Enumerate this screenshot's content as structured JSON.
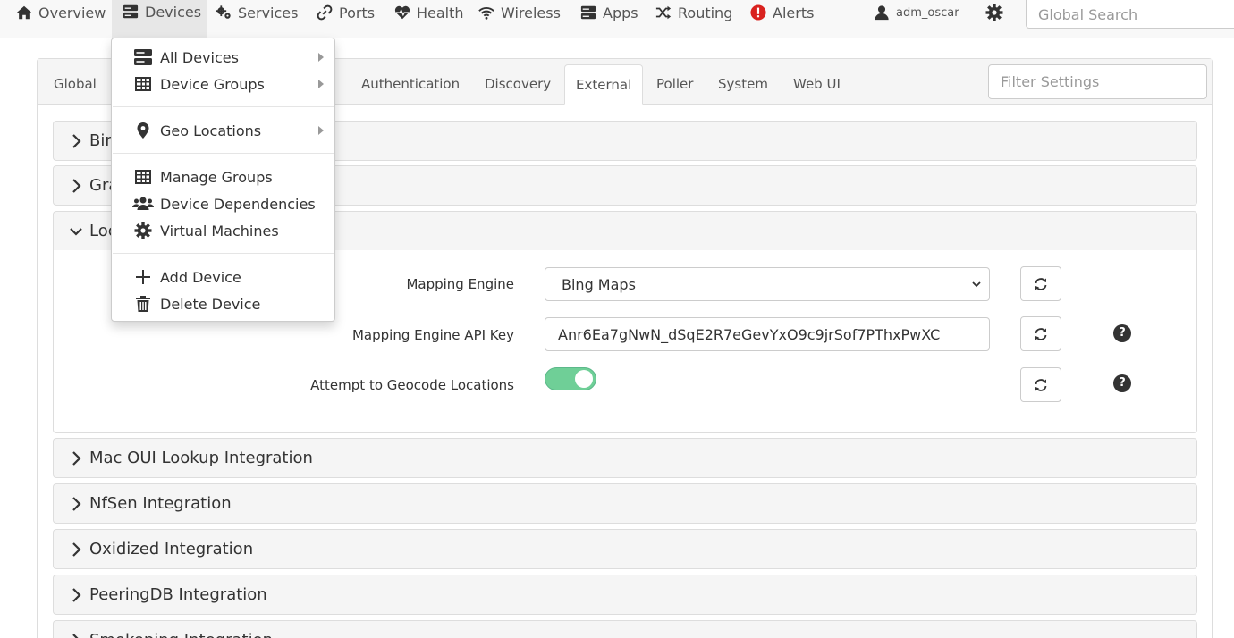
{
  "nav": {
    "items": [
      {
        "label": "Overview",
        "icon": "home-icon"
      },
      {
        "label": "Devices",
        "icon": "server-icon"
      },
      {
        "label": "Services",
        "icon": "cogs-icon"
      },
      {
        "label": "Ports",
        "icon": "link-icon"
      },
      {
        "label": "Health",
        "icon": "heartbeat-icon"
      },
      {
        "label": "Wireless",
        "icon": "wifi-icon"
      },
      {
        "label": "Apps",
        "icon": "server-icon"
      },
      {
        "label": "Routing",
        "icon": "random-icon"
      },
      {
        "label": "Alerts",
        "icon": "exclamation-circle-icon"
      }
    ],
    "user": "adm_oscar",
    "search_placeholder": "Global Search",
    "alert_color": "#d9221f"
  },
  "tabs": [
    "Global",
    "Authentication",
    "Discovery",
    "External",
    "Poller",
    "System",
    "Web UI"
  ],
  "active_tab": "External",
  "filter_placeholder": "Filter Settings",
  "sections": {
    "bing": "Bir",
    "graphing": "Gra",
    "location": "Loc",
    "mac_oui": "Mac OUI Lookup Integration",
    "nfsen": "NfSen Integration",
    "oxidized": "Oxidized Integration",
    "peeringdb": "PeeringDB Integration",
    "smokeping": "Smokeping Integration"
  },
  "location_settings": {
    "mapping_engine_label": "Mapping Engine",
    "mapping_engine_value": "Bing Maps",
    "api_key_label": "Mapping Engine API Key",
    "api_key_value": "Anr6Ea7gNwN_dSqE2R7eGevYxO9c9jrSof7PThxPwXC",
    "geocode_label": "Attempt to Geocode Locations",
    "geocode_enabled": true,
    "toggle_color": "#6fcf97"
  },
  "devices_menu": {
    "items": [
      {
        "label": "All Devices",
        "icon": "server-icon",
        "submenu": true
      },
      {
        "label": "Device Groups",
        "icon": "table-icon",
        "submenu": true
      },
      {
        "label": "Geo Locations",
        "icon": "map-marker-icon",
        "submenu": true
      },
      {
        "label": "Manage Groups",
        "icon": "table-icon",
        "submenu": false
      },
      {
        "label": "Device Dependencies",
        "icon": "users-icon",
        "submenu": false
      },
      {
        "label": "Virtual Machines",
        "icon": "cog-icon",
        "submenu": false
      },
      {
        "label": "Add Device",
        "icon": "plus-icon",
        "submenu": false
      },
      {
        "label": "Delete Device",
        "icon": "trash-icon",
        "submenu": false
      }
    ]
  },
  "help_mark": "?"
}
